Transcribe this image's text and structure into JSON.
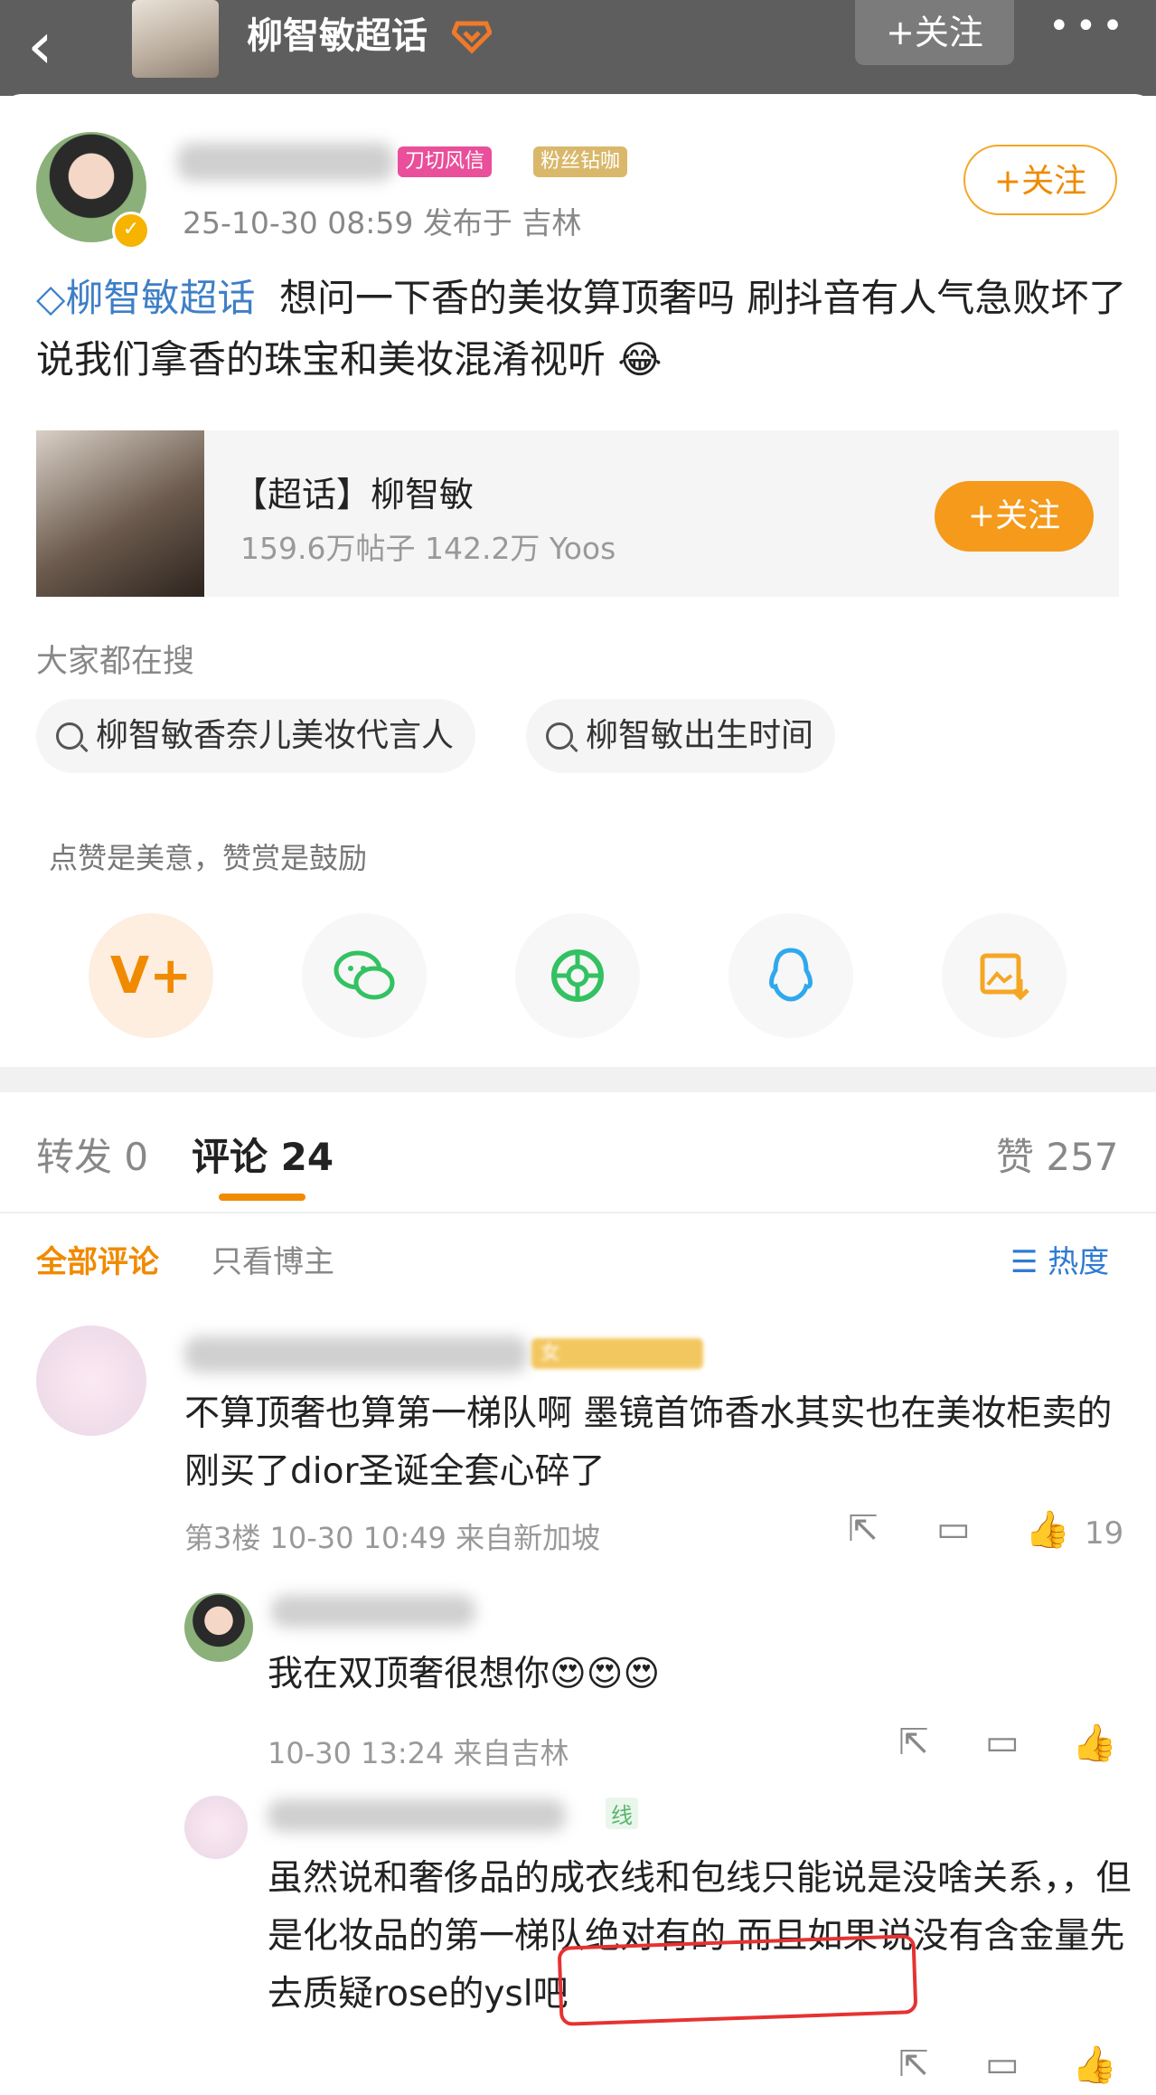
{
  "header": {
    "title": "柳智敏超话",
    "follow_label": "+关注",
    "more_label": "•••"
  },
  "post": {
    "author_tags": [
      "刀切风信",
      "粉丝钻咖"
    ],
    "meta": "25-10-30 08:59  发布于 吉林",
    "follow_label": "+关注",
    "topic_name": "柳智敏超话",
    "text": "想问一下香的美妆算顶奢吗 刷抖音有人气急败坏了说我们拿香的珠宝和美妆混淆视听"
  },
  "topic_card": {
    "title": "【超话】柳智敏",
    "stats": "159.6万帖子 142.2万 Yoos",
    "follow_label": "+关注"
  },
  "searches": {
    "label": "大家都在搜",
    "items": [
      "柳智敏香奈儿美妆代言人",
      "柳智敏出生时间"
    ]
  },
  "reward": {
    "text": "点赞是美意，赞赏是鼓励"
  },
  "tabs": {
    "repost": "转发 0",
    "comment": "评论 24",
    "like": "赞 257"
  },
  "filters": {
    "all": "全部评论",
    "owner": "只看博主",
    "sort": "热度"
  },
  "comments": [
    {
      "badge": "女",
      "text": "不算顶奢也算第一梯队啊 墨镜首饰香水其实也在美妆柜卖的 刚买了dior圣诞全套心碎了",
      "meta": "第3楼  10-30 10:49  来自新加坡",
      "likes": "19"
    }
  ],
  "replies": [
    {
      "text": "我在双顶奢很想你😍😍😍",
      "meta": "10-30 13:24  来自吉林"
    },
    {
      "tag": "线",
      "text": "虽然说和奢侈品的成衣线和包线只能说是没啥关系，，但是化妆品的第一梯队绝对有的 而且如果说没有含金量先去质疑rose的ysl吧"
    }
  ],
  "colors": {
    "accent": "#f08a00",
    "link": "#3e7fc6",
    "highlight": "#e63232"
  }
}
